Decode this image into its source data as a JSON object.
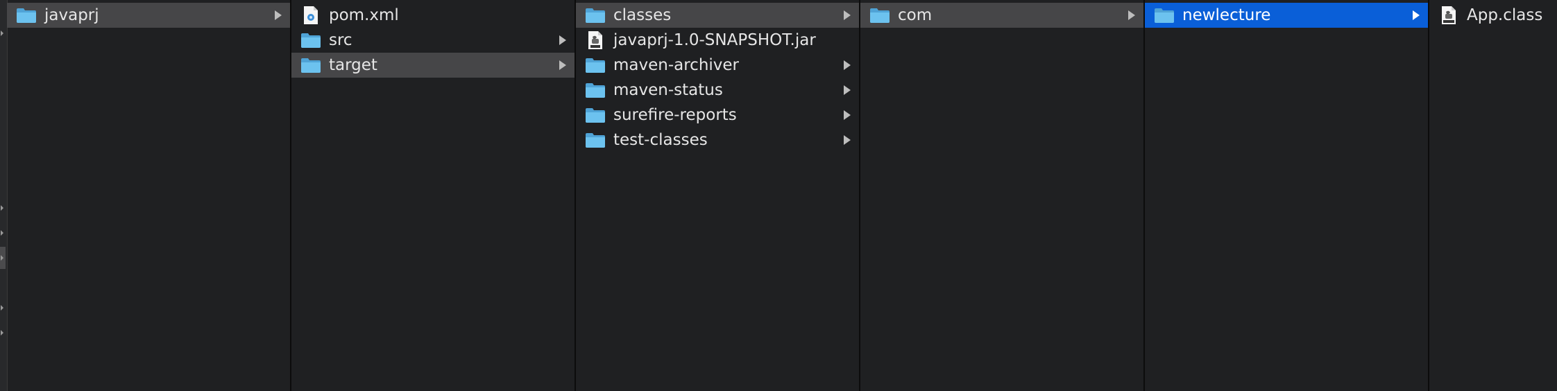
{
  "colors": {
    "background": "#1f2022",
    "selection_active": "#0a5fd8",
    "selection_inactive": "#464648",
    "folder_blue": "#5ab6e8"
  },
  "columns": [
    {
      "items": [
        {
          "label": "javaprj",
          "icon": "folder-icon",
          "has_children": true,
          "selected": "inactive"
        }
      ]
    },
    {
      "items": [
        {
          "label": "pom.xml",
          "icon": "xml-file-icon",
          "has_children": false,
          "selected": "none"
        },
        {
          "label": "src",
          "icon": "folder-icon",
          "has_children": true,
          "selected": "none"
        },
        {
          "label": "target",
          "icon": "folder-icon",
          "has_children": true,
          "selected": "inactive"
        }
      ]
    },
    {
      "items": [
        {
          "label": "classes",
          "icon": "folder-icon",
          "has_children": true,
          "selected": "inactive"
        },
        {
          "label": "javaprj-1.0-SNAPSHOT.jar",
          "icon": "jar-file-icon",
          "has_children": false,
          "selected": "none"
        },
        {
          "label": "maven-archiver",
          "icon": "folder-icon",
          "has_children": true,
          "selected": "none"
        },
        {
          "label": "maven-status",
          "icon": "folder-icon",
          "has_children": true,
          "selected": "none"
        },
        {
          "label": "surefire-reports",
          "icon": "folder-icon",
          "has_children": true,
          "selected": "none"
        },
        {
          "label": "test-classes",
          "icon": "folder-icon",
          "has_children": true,
          "selected": "none"
        }
      ]
    },
    {
      "items": [
        {
          "label": "com",
          "icon": "folder-icon",
          "has_children": true,
          "selected": "inactive"
        }
      ]
    },
    {
      "items": [
        {
          "label": "newlecture",
          "icon": "folder-icon",
          "has_children": true,
          "selected": "active"
        }
      ]
    },
    {
      "items": [
        {
          "label": "App.class",
          "icon": "class-file-icon",
          "has_children": false,
          "selected": "none"
        }
      ]
    }
  ]
}
